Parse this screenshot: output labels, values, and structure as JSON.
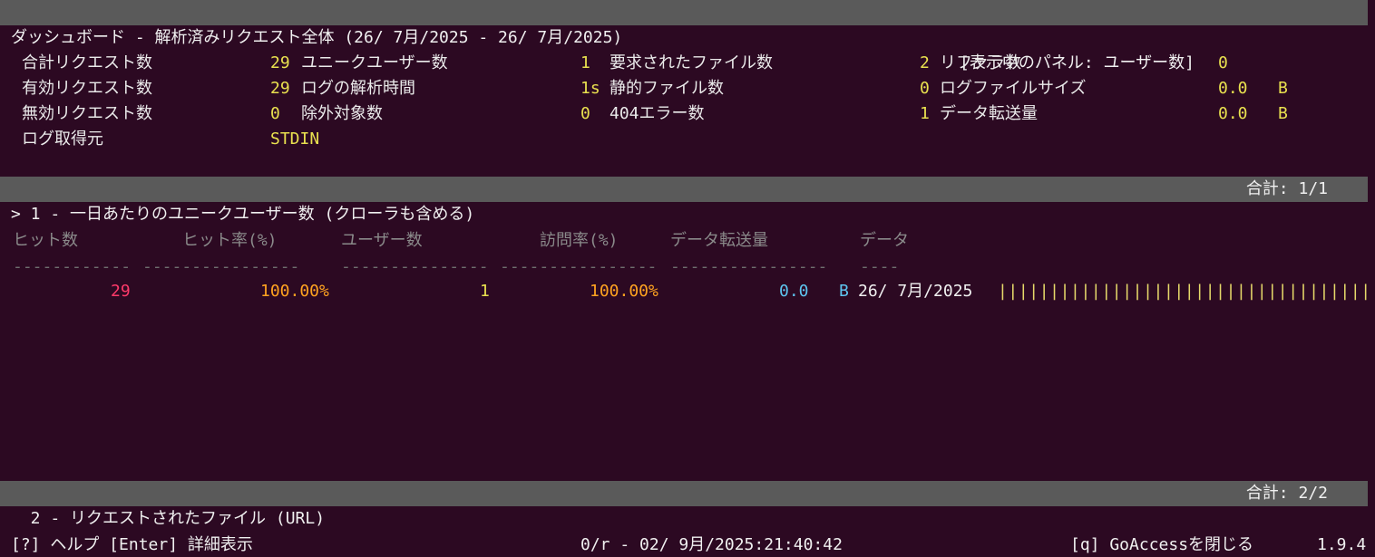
{
  "header": {
    "title": "ダッシュボード - 解析済みリクエスト全体 (26/ 7月/2025 - 26/ 7月/2025)",
    "active_panel": "[表示中のパネル: ユーザー数]"
  },
  "overview": {
    "total_requests_label": "合計リクエスト数",
    "total_requests": "29",
    "unique_visitors_label": "ユニークユーザー数",
    "unique_visitors": "1",
    "requested_files_label": "要求されたファイル数",
    "requested_files": "2",
    "referrers_label": "リファラ数",
    "referrers": "0",
    "valid_requests_label": "有効リクエスト数",
    "valid_requests": "29",
    "log_parse_time_label": "ログの解析時間",
    "log_parse_time": "1s",
    "static_files_label": "静的ファイル数",
    "static_files": "0",
    "log_size_label": "ログファイルサイズ",
    "log_size": "0.0",
    "log_size_unit": "B",
    "failed_requests_label": "無効リクエスト数",
    "failed_requests": "0",
    "excluded_hits_label": "除外対象数",
    "excluded_hits": "0",
    "not_found_label": "404エラー数",
    "not_found": "1",
    "bandwidth_label": "データ転送量",
    "bandwidth": "0.0",
    "bandwidth_unit": "B",
    "log_source_label": "ログ取得元",
    "log_source": "STDIN"
  },
  "panel1": {
    "title": "> 1 - 一日あたりのユニークユーザー数 (クローラも含める)",
    "total": "合計: 1/1",
    "columns": {
      "hits": "ヒット数",
      "hits_pct": "ヒット率(%)",
      "visitors": "ユーザー数",
      "visitors_pct": "訪問率(%)",
      "bandwidth": "データ転送量",
      "data": "データ"
    },
    "dashes": {
      "hits": "------------",
      "hits_pct": "----------------",
      "visitors": "---------------",
      "visitors_pct": "----------------",
      "bandwidth": "----------------",
      "data": "----"
    },
    "rows": [
      {
        "hits": "29",
        "hits_pct": "100.00%",
        "visitors": "1",
        "visitors_pct": "100.00%",
        "bandwidth": "0.0",
        "bandwidth_unit": "B",
        "data": "26/ 7月/2025",
        "bar": "|||||||||||||||||||||||||||||||||||||||||||||||||||||||||||||"
      }
    ]
  },
  "panel2": {
    "title": "  2 - リクエストされたファイル (URL)",
    "total": "合計: 2/2"
  },
  "footer": {
    "help": "[?] ヘルプ [Enter] 詳細表示",
    "status": "0/r - 02/ 9月/2025:21:40:42",
    "quit": "[q] GoAccessを閉じる",
    "version": "1.9.4"
  },
  "colors": {
    "background": "#2c0922",
    "bar": "#5a5a5a",
    "value_yellow": "#e9e14f",
    "hits_red": "#ff3a6a",
    "percent_orange": "#ffa320",
    "bandwidth_cyan": "#5ec5f0"
  }
}
